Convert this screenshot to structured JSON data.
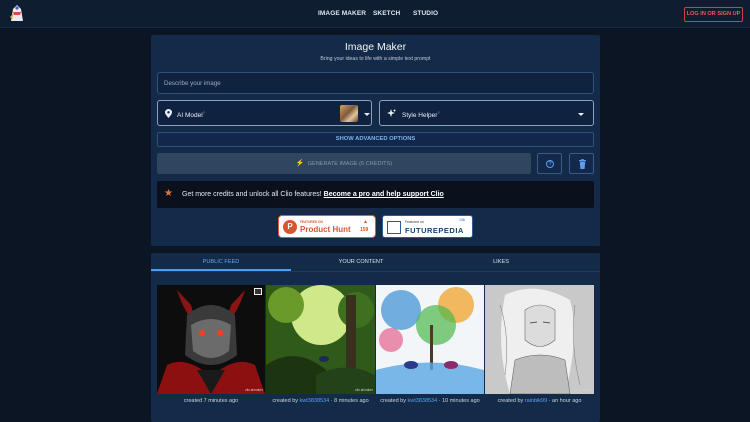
{
  "header": {
    "nav": [
      "IMAGE MAKER",
      "SKETCH",
      "STUDIO"
    ],
    "login_label": "LOG IN OR SIGN UP"
  },
  "maker": {
    "title": "Image Maker",
    "subtitle": "Bring your ideas to life with a simple text prompt",
    "prompt_placeholder": "Describe your image",
    "model_label": "AI Model",
    "style_label": "Style Helper",
    "help_mark": "?",
    "advanced_label": "SHOW ADVANCED OPTIONS",
    "generate_label": "GENERATE IMAGE (6 CREDITS)",
    "banner_text": "Get more credits and unlock all Clio features!",
    "banner_link": "Become a pro and help support Clio"
  },
  "badges": {
    "producthunt": {
      "small": "FEATURED ON",
      "name": "Product Hunt",
      "count": "159"
    },
    "futurepedia": {
      "small": "Featured on",
      "name": "FUTUREPEDIA",
      "count": "136"
    }
  },
  "feed": {
    "tabs": [
      "PUBLIC FEED",
      "YOUR CONTENT",
      "LIKES"
    ],
    "active_tab": 0,
    "items": [
      {
        "prefix": "",
        "user": "",
        "time": "created 7 minutes ago",
        "watermark": "clio.ai/maker"
      },
      {
        "prefix": "created by ",
        "user": "kwt3838534",
        "time": " · 8 minutes ago",
        "watermark": "clio.ai/maker"
      },
      {
        "prefix": "created by ",
        "user": "kwt3838534",
        "time": " · 10 minutes ago",
        "watermark": ""
      },
      {
        "prefix": "created by ",
        "user": "rainbik99",
        "time": " · an hour ago",
        "watermark": "clio.ai/maker"
      }
    ]
  },
  "colors": {
    "accent": "#4e9cf0",
    "danger": "#ef5a5a",
    "bg": "#0b1524",
    "card": "#132a48"
  }
}
